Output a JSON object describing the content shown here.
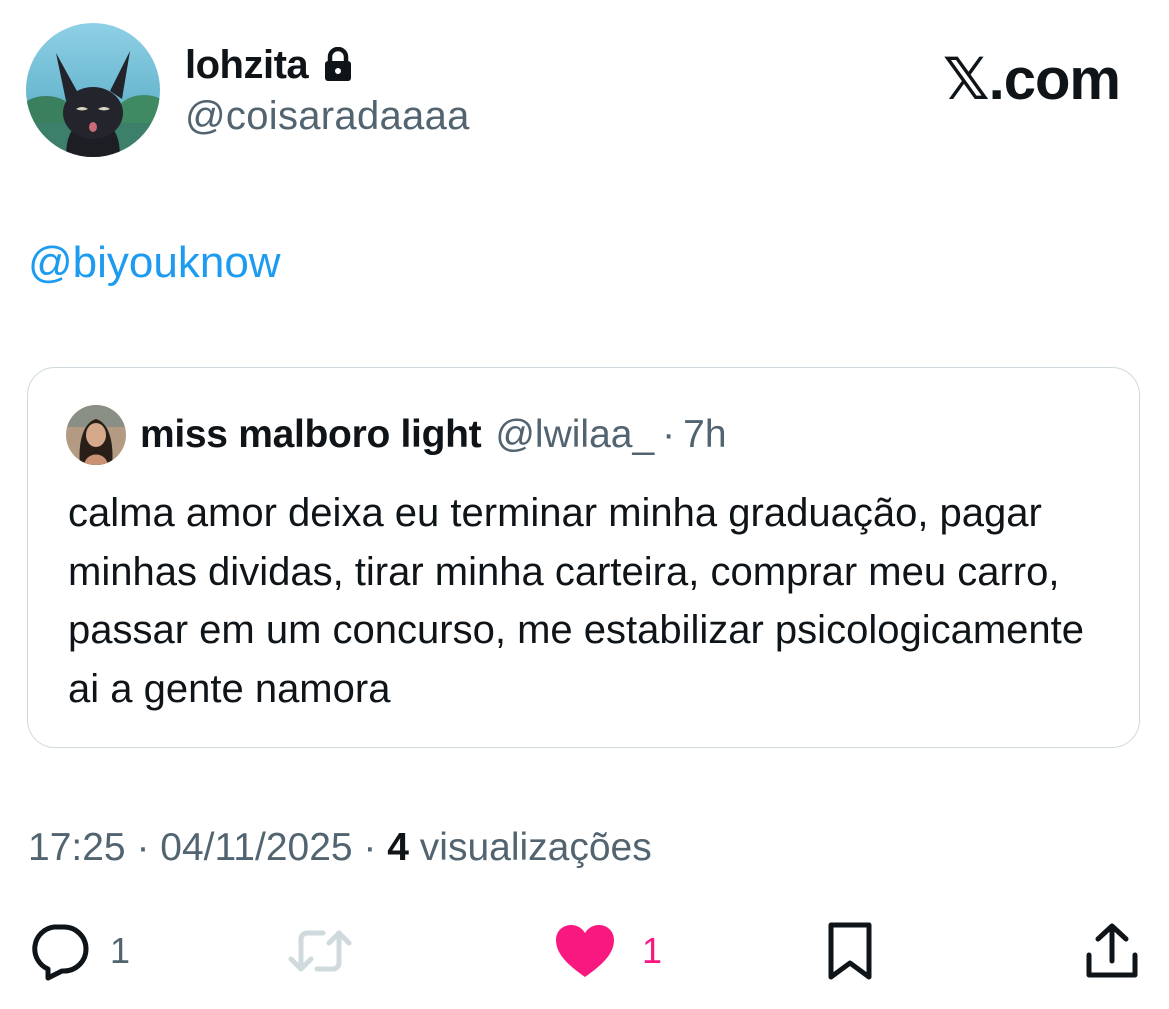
{
  "author": {
    "display_name": "lohzita",
    "handle": "@coisaradaaaa",
    "protected_icon": "lock-icon",
    "avatar": "cat-avatar"
  },
  "brand": {
    "label": "𝕏.com"
  },
  "tweet": {
    "mention": "@biyouknow"
  },
  "quoted_tweet": {
    "display_name": "miss malboro light",
    "handle": "@lwilaa_",
    "separator": "·",
    "time": "7h",
    "text": "calma amor deixa eu terminar minha graduação, pagar minhas dividas, tirar minha carteira, comprar meu carro, passar em um concurso, me estabilizar psicologicamente ai a gente namora",
    "avatar": "photo-avatar"
  },
  "meta": {
    "time": "17:25",
    "separator": " · ",
    "date": "04/11/2025",
    "views_count": "4",
    "views_label": " visualizações"
  },
  "actions": {
    "reply_count": "1",
    "like_count": "1",
    "icons": [
      "reply-icon",
      "retweet-icon",
      "like-icon",
      "bookmark-icon",
      "share-icon"
    ]
  },
  "colors": {
    "text": "#0f1419",
    "secondary": "#536471",
    "link": "#1d9bf0",
    "like": "#f91880",
    "border": "#cfd9de",
    "retweet_inactive": "#cfd9de"
  }
}
